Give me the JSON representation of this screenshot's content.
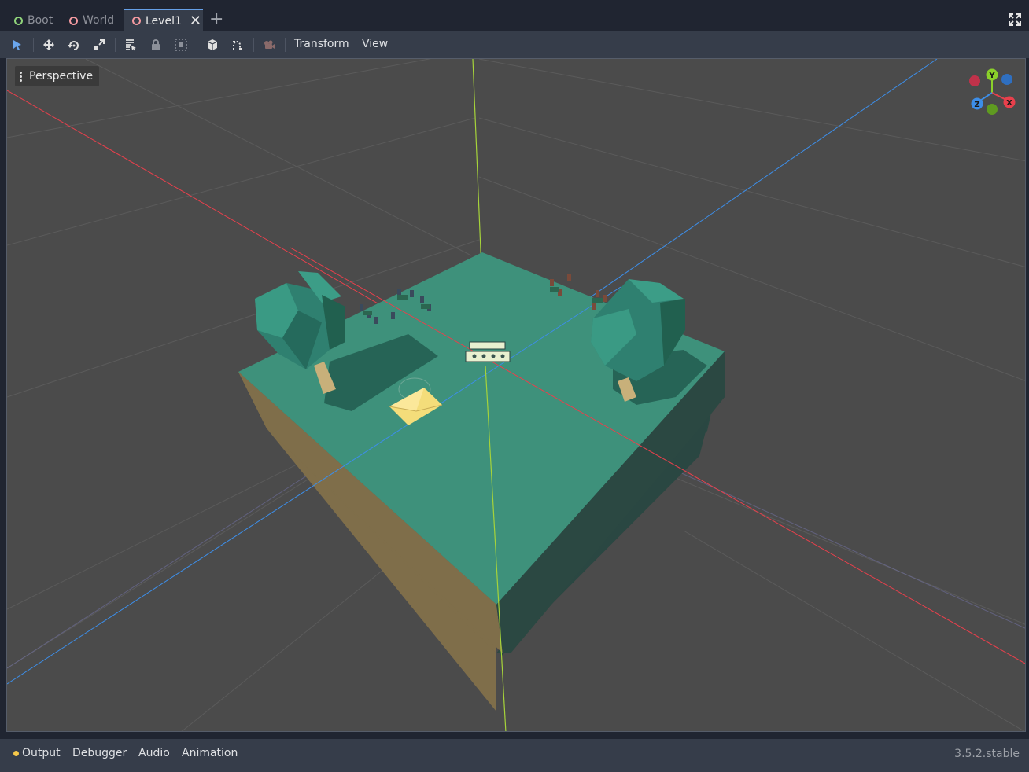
{
  "tabs": [
    {
      "label": "Boot",
      "ring_color": "#8fd37a"
    },
    {
      "label": "World",
      "ring_color": "#f49aa0"
    },
    {
      "label": "Level1",
      "ring_color": "#f49aa0"
    }
  ],
  "toolbar": {
    "transform_label": "Transform",
    "view_label": "View"
  },
  "viewport": {
    "perspective_label": "Perspective",
    "gizmo": {
      "y": "Y",
      "x": "X",
      "z": "Z"
    }
  },
  "bottom_panel": {
    "tabs": [
      "Output",
      "Debugger",
      "Audio",
      "Animation"
    ],
    "version": "3.5.2.stable"
  },
  "colors": {
    "accent": "#65a0e8",
    "axis_x": "#e8404c",
    "axis_y": "#8bd12a",
    "axis_z": "#3d8ee8",
    "ground_top": "#3e917b",
    "ground_side": "#7f6e4a"
  }
}
